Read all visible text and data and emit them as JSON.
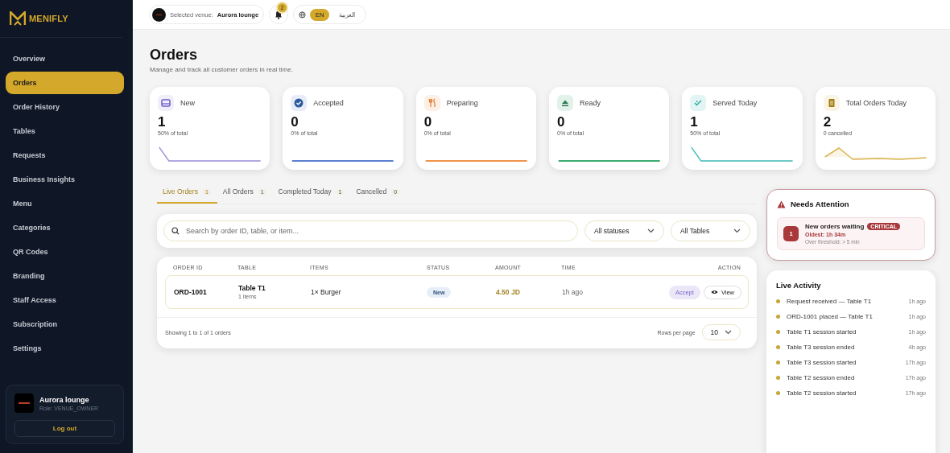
{
  "brand": {
    "name": "MENIFLY"
  },
  "sidebar": {
    "items": [
      {
        "label": "Overview",
        "selected": false
      },
      {
        "label": "Orders",
        "selected": true
      },
      {
        "label": "Order History",
        "selected": false
      },
      {
        "label": "Tables",
        "selected": false
      },
      {
        "label": "Requests",
        "selected": false
      },
      {
        "label": "Business Insights",
        "selected": false
      },
      {
        "label": "Menu",
        "selected": false
      },
      {
        "label": "Categories",
        "selected": false
      },
      {
        "label": "QR Codes",
        "selected": false
      },
      {
        "label": "Branding",
        "selected": false
      },
      {
        "label": "Staff Access",
        "selected": false
      },
      {
        "label": "Subscription",
        "selected": false
      },
      {
        "label": "Settings",
        "selected": false
      }
    ],
    "user": {
      "name": "Aurora lounge",
      "role": "Role: VENUE_OWNER",
      "logout": "Log out"
    }
  },
  "topbar": {
    "venue_label": "Selected venue:",
    "venue": "Aurora lounge",
    "notifications": "2",
    "languages": [
      {
        "label": "EN",
        "selected": true
      },
      {
        "label": "العربية",
        "selected": false
      }
    ]
  },
  "page": {
    "title": "Orders",
    "subtitle": "Manage and track all customer orders in real time."
  },
  "stats": [
    {
      "kind": "new",
      "label": "New",
      "value": "1",
      "note": "50% of total",
      "color": "#9a8ad8"
    },
    {
      "kind": "accepted",
      "label": "Accepted",
      "value": "0",
      "note": "0% of total",
      "color": "#5b7fd0"
    },
    {
      "kind": "preparing",
      "label": "Preparing",
      "value": "0",
      "note": "0% of total",
      "color": "#f0944a"
    },
    {
      "kind": "ready",
      "label": "Ready",
      "value": "0",
      "note": "0% of total",
      "color": "#3aaa6f"
    },
    {
      "kind": "served",
      "label": "Served Today",
      "value": "1",
      "note": "50% of total",
      "color": "#3bbbb5"
    },
    {
      "kind": "total",
      "label": "Total Orders Today",
      "value": "2",
      "note": "0 cancelled",
      "color": "#d9b24c"
    }
  ],
  "tabs": [
    {
      "label": "Live Orders",
      "count": "1",
      "selected": true
    },
    {
      "label": "All Orders",
      "count": "1",
      "selected": false
    },
    {
      "label": "Completed Today",
      "count": "1",
      "selected": false
    },
    {
      "label": "Cancelled",
      "count": "0",
      "selected": false
    }
  ],
  "filters": {
    "search_placeholder": "Search by order ID, table, or item...",
    "status": "All statuses",
    "table": "All Tables"
  },
  "orders": {
    "columns": [
      "ORDER ID",
      "TABLE",
      "ITEMS",
      "STATUS",
      "AMOUNT",
      "TIME",
      "ACTION"
    ],
    "rows": [
      {
        "order_id": "ORD-1001",
        "table": "Table T1",
        "items_count": "1 items",
        "items": "1× Burger",
        "status": "New",
        "amount": "4.50 JD",
        "time": "1h ago",
        "actions": [
          {
            "kind": "accept",
            "label": "Accept"
          },
          {
            "kind": "view",
            "label": "View"
          }
        ]
      }
    ],
    "footer": "Showing 1 to 1 of 1 orders",
    "rows_per_page_label": "Rows per page",
    "rows_per_page": "10"
  },
  "attention": {
    "title": "Needs Attention",
    "alerts": [
      {
        "count": "1",
        "title": "New orders waiting",
        "badge": "CRITICAL",
        "oldest": "Oldest: 1h 34m",
        "threshold": "Over threshold: > 5 min"
      }
    ]
  },
  "activity": {
    "title": "Live Activity",
    "items": [
      {
        "text": "Request received — Table T1",
        "time": "1h ago"
      },
      {
        "text": "ORD-1001 placed — Table T1",
        "time": "1h ago"
      },
      {
        "text": "Table T1 session started",
        "time": "1h ago"
      },
      {
        "text": "Table T3 session ended",
        "time": "4h ago"
      },
      {
        "text": "Table T3 session started",
        "time": "17h ago"
      },
      {
        "text": "Table T2 session ended",
        "time": "17h ago"
      },
      {
        "text": "Table T2 session started",
        "time": "17h ago"
      }
    ]
  }
}
